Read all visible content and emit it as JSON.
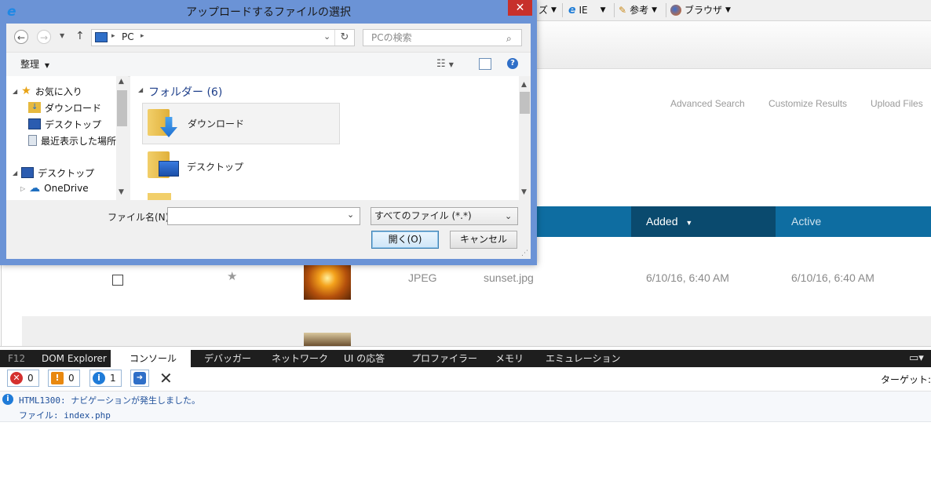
{
  "browser": {
    "toolbar": {
      "zu_label": "ズ",
      "ie_label": "IE",
      "sanko_label": "参考",
      "browser_label": "ブラウザ"
    },
    "links": {
      "advanced_search": "Advanced Search",
      "customize_results": "Customize Results",
      "upload_files": "Upload Files"
    },
    "table": {
      "col_added": "Added",
      "col_active": "Active",
      "rows": [
        {
          "type": "JPEG",
          "name": "sunset.jpg",
          "added": "6/10/16, 6:40 AM",
          "active": "6/10/16, 6:40 AM"
        }
      ]
    }
  },
  "dialog": {
    "title": "アップロードするファイルの選択",
    "close_glyph": "✕",
    "address": {
      "crumb": "PC"
    },
    "search_placeholder": "PCの検索",
    "organize_label": "整理",
    "nav_tree": [
      {
        "label": "お気に入り"
      },
      {
        "label": "ダウンロード"
      },
      {
        "label": "デスクトップ"
      },
      {
        "label": "最近表示した場所"
      },
      {
        "label": "デスクトップ"
      },
      {
        "label": "OneDrive"
      }
    ],
    "group_header": "フォルダー (6)",
    "folders": [
      {
        "label": "ダウンロード"
      },
      {
        "label": "デスクトップ"
      }
    ],
    "filename_label": "ファイル名(N):",
    "filename_value": "",
    "filetype_value": "すべてのファイル (*.*)",
    "open_button": "開く(O)",
    "cancel_button": "キャンセル"
  },
  "devtools": {
    "f12_label": "F12",
    "tabs": [
      "DOM Explorer",
      "コンソール",
      "デバッガー",
      "ネットワーク",
      "UI の応答",
      "プロファイラー",
      "メモリ",
      "エミュレーション"
    ],
    "active_tab": "コンソール",
    "counters": {
      "errors": "0",
      "warnings": "0",
      "info": "1"
    },
    "target_label": "ターゲット:",
    "message": {
      "code": "HTML1300: ナビゲーションが発生しました。",
      "file_line": "ファイル: index.php"
    }
  },
  "colors": {
    "dialog_frame": "#6b93d6",
    "table_header": "#0e6da1",
    "table_header_active": "#0a4a6e",
    "close_red": "#c7302b"
  }
}
